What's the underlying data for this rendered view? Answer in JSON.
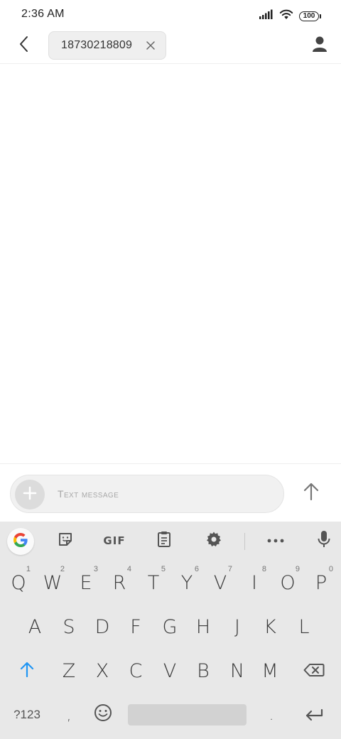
{
  "status_bar": {
    "time": "2:36 AM",
    "battery": "100",
    "icons": [
      "signal-icon",
      "wifi-icon",
      "battery-icon"
    ]
  },
  "header": {
    "back_icon": "chevron-left-icon",
    "recipient": "18730218809",
    "remove_icon": "close-icon",
    "contact_icon": "person-icon"
  },
  "compose": {
    "placeholder": "Text message",
    "value": "",
    "attach_icon": "plus-icon",
    "send_icon": "arrow-up-icon"
  },
  "keyboard": {
    "toolbar": {
      "gif_label": "GIF",
      "icons": [
        "google-icon",
        "sticker-icon",
        "clipboard-icon",
        "gear-icon",
        "more-icon",
        "microphone-icon"
      ]
    },
    "row1": [
      {
        "key": "Q",
        "hint": "1"
      },
      {
        "key": "W",
        "hint": "2"
      },
      {
        "key": "E",
        "hint": "3"
      },
      {
        "key": "R",
        "hint": "4"
      },
      {
        "key": "T",
        "hint": "5"
      },
      {
        "key": "Y",
        "hint": "6"
      },
      {
        "key": "V",
        "hint": "7"
      },
      {
        "key": "I",
        "hint": "8"
      },
      {
        "key": "O",
        "hint": "9"
      },
      {
        "key": "P",
        "hint": "0"
      }
    ],
    "row2": [
      "A",
      "S",
      "D",
      "F",
      "G",
      "H",
      "J",
      "K",
      "L"
    ],
    "row3": [
      "Z",
      "X",
      "C",
      "V",
      "B",
      "N",
      "M"
    ],
    "row4": {
      "symbols_label": "?123",
      "comma": ",",
      "period": "."
    },
    "accent_color": "#2196f3"
  }
}
